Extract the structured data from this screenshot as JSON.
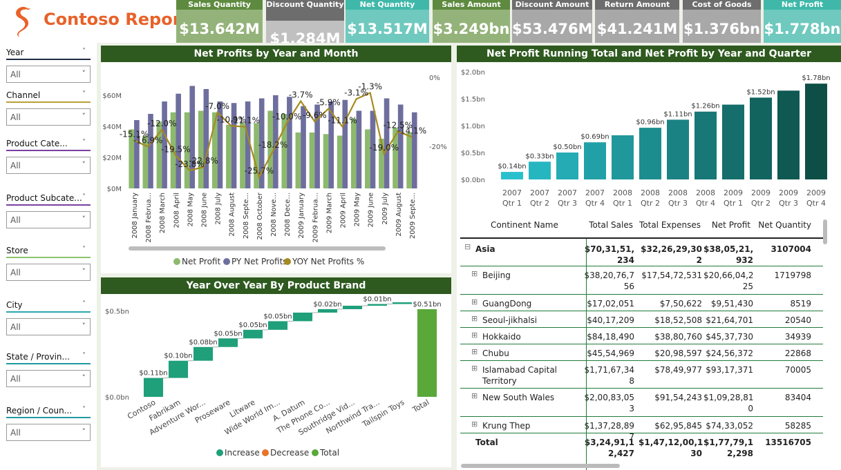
{
  "app": {
    "title": "Contoso Report"
  },
  "kpis": [
    {
      "label": "Sales Quantity",
      "value": "$13.642M",
      "color": "#5e8a3f"
    },
    {
      "label": "Discount Quantity",
      "value": "$1.284M",
      "color": "#6d6d6d"
    },
    {
      "label": "Net Quantity",
      "value": "$13.517M",
      "color": "#3fb8a9"
    },
    {
      "label": "Sales Amount",
      "value": "$3.249bn",
      "color": "#5e8a3f"
    },
    {
      "label": "Discount Amount",
      "value": "$53.476M",
      "color": "#6d6d6d"
    },
    {
      "label": "Return Amount",
      "value": "$41.241M",
      "color": "#6d6d6d"
    },
    {
      "label": "Cost of Goods",
      "value": "$1.376bn",
      "color": "#6d6d6d"
    },
    {
      "label": "Net Profit",
      "value": "$1.778bn",
      "color": "#3fb8a9"
    }
  ],
  "slicers": [
    {
      "label": "Year",
      "value": "All",
      "color": "#1f2a44"
    },
    {
      "label": "Channel",
      "value": "All",
      "color": "#b9a13a"
    },
    {
      "label": "Product Cate...",
      "value": "All",
      "color": "#7a3fa0"
    },
    {
      "label": "Product Subcate...",
      "value": "All",
      "color": "#7a3fa0"
    },
    {
      "label": "Store",
      "value": "All",
      "color": "#8cc36a"
    },
    {
      "label": "City",
      "value": "All",
      "color": "#2aa6b0"
    },
    {
      "label": "State / Provin...",
      "value": "All",
      "color": "#1f9aa0"
    },
    {
      "label": "Region / Coun...",
      "value": "All",
      "color": "#1f9aa0"
    }
  ],
  "chart_titles": {
    "monthly": "Net Profits by Year and Month",
    "quarterly": "Net Profit Running Total and Net Profit by Year and Quarter",
    "waterfall": "Year Over Year By Product Brand"
  },
  "chart_data": [
    {
      "type": "bar",
      "title": "Net Profits by Year and Month",
      "categories": [
        "2008 January",
        "2008 Februa...",
        "2008 March",
        "2008 April",
        "2008 May",
        "2008 June",
        "2008 July",
        "2008 August",
        "2008 Septe...",
        "2008 October",
        "2008 Nove...",
        "2008 Dece...",
        "2009 January",
        "2009 Februa...",
        "2009 March",
        "2009 April",
        "2009 May",
        "2009 June",
        "2009 July",
        "2009 August",
        "2009 Septe..."
      ],
      "series": [
        {
          "name": "Net Profit",
          "type": "bar",
          "color": "#8db96d",
          "values": [
            38,
            34,
            43,
            49,
            49,
            50,
            49,
            41,
            42,
            42,
            50,
            48,
            36,
            36,
            35,
            34,
            45,
            38,
            32,
            39,
            36
          ]
        },
        {
          "name": "PY Net Profits",
          "type": "bar",
          "color": "#6e6e9e",
          "values": [
            44,
            48,
            56,
            61,
            66,
            64,
            56,
            55,
            56,
            58,
            60,
            59,
            53,
            54,
            56,
            57,
            50,
            50,
            58,
            54,
            49
          ]
        },
        {
          "name": "YOY Net Profits %",
          "type": "line",
          "color": "#a68a1f",
          "values": [
            -15.1,
            -16.9,
            -12.0,
            -19.5,
            -23.8,
            -22.8,
            -7.0,
            -10.9,
            -11.1,
            -25.7,
            -18.2,
            -10.0,
            -3.7,
            -9.6,
            -5.9,
            -11.1,
            -3.1,
            -1.3,
            -19.0,
            -12.5,
            -14.1
          ]
        }
      ],
      "y_left_ticks": [
        "$0M",
        "$20M",
        "$40M",
        "$60M"
      ],
      "y_left_range": [
        0,
        60
      ],
      "y_right_ticks": [
        "0%",
        "-20%"
      ],
      "y_right_range": [
        -30,
        0
      ],
      "data_labels": [
        "-15.1%",
        "-16.9%",
        "-12.0%",
        "-19.5%",
        "-23.8%",
        "-22.8%",
        "-7.0%",
        "-10.9%",
        "-11.1%",
        "-25.7%",
        "-18.2%",
        "-10.0%",
        "-3.7%",
        "-9.6%",
        "-5.9%",
        "-11.1%",
        "-3.1%",
        "-1.3%",
        "-19.0%",
        "-12.5%",
        "-14.1%"
      ],
      "legend": {
        "position": "bottom",
        "items": [
          "Net Profit",
          "PY Net Profits",
          "YOY Net Profits %"
        ]
      }
    },
    {
      "type": "bar",
      "title": "Net Profit Running Total and Net Profit by Year and Quarter",
      "categories": [
        "2007 Qtr 1",
        "2007 Qtr 2",
        "2007 Qtr 3",
        "2007 Qtr 4",
        "2008 Qtr 1",
        "2008 Qtr 2",
        "2008 Qtr 3",
        "2008 Qtr 4",
        "2009 Qtr 1",
        "2009 Qtr 2",
        "2009 Qtr 3",
        "2009 Qtr 4"
      ],
      "values": [
        0.14,
        0.33,
        0.5,
        0.69,
        0.82,
        0.96,
        1.11,
        1.26,
        1.39,
        1.52,
        1.65,
        1.78
      ],
      "data_labels": [
        "$0.14bn",
        "$0.33bn",
        "$0.50bn",
        "$0.69bn",
        "",
        "$0.96bn",
        "$1.11bn",
        "$1.26bn",
        "",
        "$1.52bn",
        "",
        "$1.78bn"
      ],
      "y_ticks": [
        "$0.0bn",
        "$0.5bn",
        "$1.0bn",
        "$1.5bn",
        "$2.0bn"
      ],
      "ylim": [
        0,
        2.0
      ],
      "color_start": "#29c0cc",
      "color_end": "#0d4f46"
    },
    {
      "type": "bar",
      "title": "Year Over Year By Product Brand",
      "categories": [
        "Contoso",
        "Fabrikam",
        "Adventure Wor...",
        "Proseware",
        "Litware",
        "Wide World Im...",
        "A. Datum",
        "The Phone Co...",
        "Southridge Vid...",
        "Northwind Tra...",
        "Tailspin Toys",
        "Total"
      ],
      "values": [
        0.11,
        0.1,
        0.08,
        0.05,
        0.05,
        0.05,
        0.05,
        0.02,
        0.02,
        0.01,
        0.01,
        0.51
      ],
      "data_labels": [
        "$0.11bn",
        "$0.10bn",
        "$0.08bn",
        "$0.05bn",
        "$0.05bn",
        "$0.05bn",
        "",
        "$0.02bn",
        "",
        "$0.01bn",
        "",
        "$0.51bn"
      ],
      "y_ticks": [
        "$0.0bn",
        "$0.5bn"
      ],
      "ylim": [
        0,
        0.55
      ],
      "legend": {
        "position": "bottom",
        "items": [
          {
            "name": "Increase",
            "color": "#1f9f7a"
          },
          {
            "name": "Decrease",
            "color": "#e8742a"
          },
          {
            "name": "Total",
            "color": "#5aa83a"
          }
        ]
      }
    }
  ],
  "matrix": {
    "headers": [
      "Continent Name",
      "Total Sales",
      "Total Expenses",
      "Net Profit",
      "Net Quantity"
    ],
    "rows": [
      {
        "name": "Asia",
        "expander": "⊟",
        "bold": true,
        "sales": "$70,31,51,\n234",
        "expenses": "$32,26,29,30\n2",
        "profit": "$38,05,21,\n932",
        "qty": "3107004"
      },
      {
        "name": "Beijing",
        "expander": "⊞",
        "bold": false,
        "sales": "$38,20,76,7\n56",
        "expenses": "$17,54,72,531",
        "profit": "$20,66,04,2\n25",
        "qty": "1719798"
      },
      {
        "name": "GuangDong",
        "expander": "⊞",
        "bold": false,
        "sales": "$17,02,051",
        "expenses": "$7,50,622",
        "profit": "$9,51,430",
        "qty": "8519"
      },
      {
        "name": "Seoul-jikhalsi",
        "expander": "⊞",
        "bold": false,
        "sales": "$40,17,209",
        "expenses": "$18,52,508",
        "profit": "$21,64,701",
        "qty": "20540"
      },
      {
        "name": "Hokkaido",
        "expander": "⊞",
        "bold": false,
        "sales": "$84,18,490",
        "expenses": "$38,80,760",
        "profit": "$45,37,730",
        "qty": "34939"
      },
      {
        "name": "Chubu",
        "expander": "⊞",
        "bold": false,
        "sales": "$45,54,969",
        "expenses": "$20,98,597",
        "profit": "$24,56,372",
        "qty": "22868"
      },
      {
        "name": "Islamabad Capital\nTerritory",
        "expander": "⊞",
        "bold": false,
        "sales": "$1,71,67,34\n8",
        "expenses": "$78,49,977",
        "profit": "$93,17,371",
        "qty": "70005"
      },
      {
        "name": "New South Wales",
        "expander": "⊞",
        "bold": false,
        "sales": "$2,00,83,05\n3",
        "expenses": "$91,54,243",
        "profit": "$1,09,28,81\n0",
        "qty": "83404"
      },
      {
        "name": "Krung Thep",
        "expander": "⊞",
        "bold": false,
        "sales": "$1,37,28,89\n7",
        "expenses": "$62,95,845",
        "profit": "$74,33,052",
        "qty": "58285"
      }
    ],
    "total": {
      "name": "Total",
      "sales": "$3,24,91,1\n2,427",
      "expenses": "$1,47,12,00,1\n30",
      "profit": "$1,77,79,1\n2,298",
      "qty": "13516705"
    }
  }
}
